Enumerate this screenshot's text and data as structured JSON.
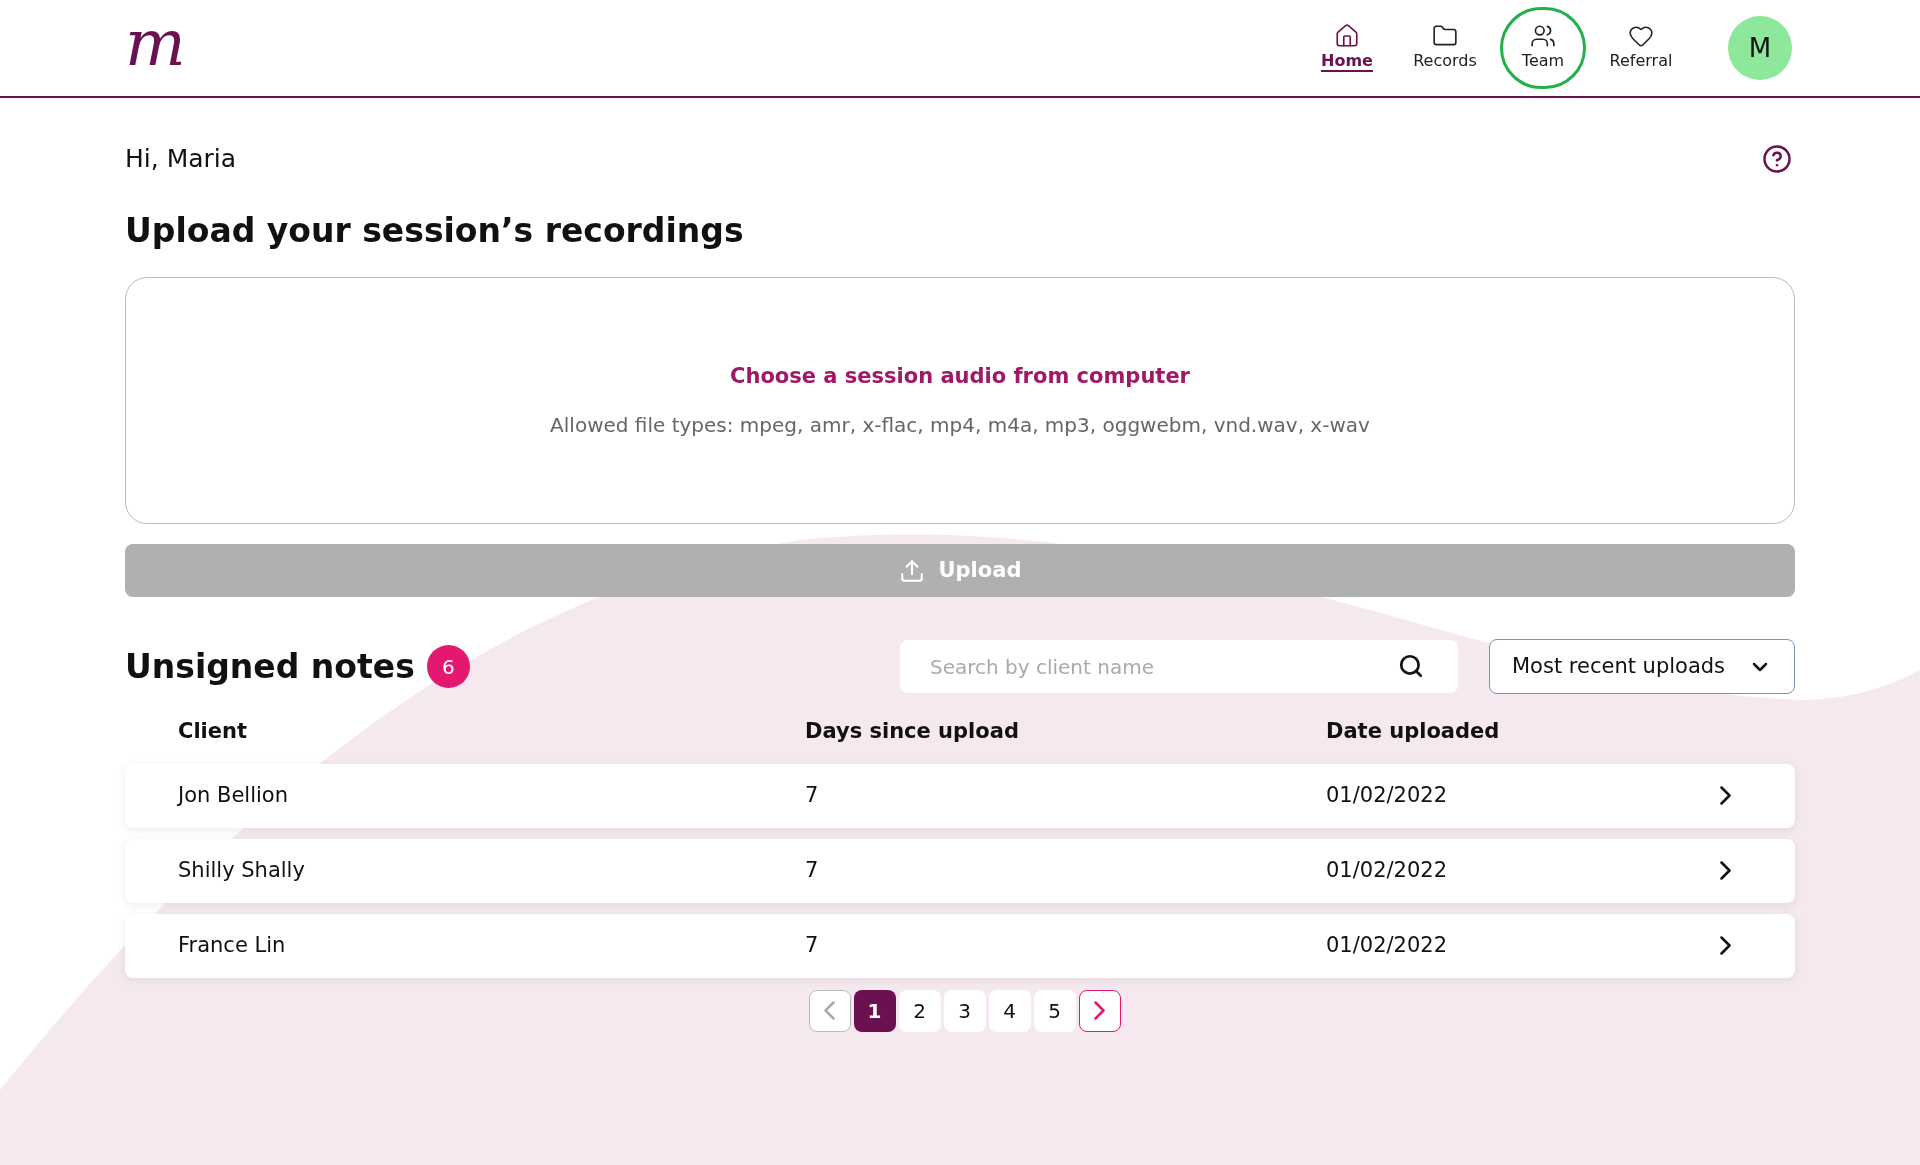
{
  "header": {
    "logo": "m",
    "nav": [
      {
        "label": "Home",
        "selected": true,
        "focused": false
      },
      {
        "label": "Records",
        "selected": false,
        "focused": false
      },
      {
        "label": "Team",
        "selected": false,
        "focused": true
      },
      {
        "label": "Referral",
        "selected": false,
        "focused": false
      }
    ],
    "avatar": "M"
  },
  "greeting": "Hi, Maria",
  "title": "Upload your session’s recordings",
  "dropzone": {
    "link": "Choose a session audio from computer",
    "hint": "Allowed file types: mpeg, amr, x-flac, mp4, m4a, mp3, oggwebm, vnd.wav, x-wav"
  },
  "upload_button": {
    "label": "Upload",
    "disabled": true
  },
  "notes": {
    "title": "Unsigned notes",
    "count": "6",
    "search": {
      "placeholder": "Search by client name"
    },
    "sort": {
      "value": "Most recent uploads"
    },
    "columns": [
      "Client",
      "Days since upload",
      "Date uploaded"
    ],
    "rows": [
      [
        "Jon Bellion",
        "7",
        "01/02/2022"
      ],
      [
        "Shilly Shally",
        "7",
        "01/02/2022"
      ],
      [
        "France Lin",
        "7",
        "01/02/2022"
      ]
    ]
  },
  "pagination": {
    "prev_disabled": true,
    "next_disabled": false,
    "pages": [
      {
        "label": "1",
        "selected": true
      },
      {
        "label": "2",
        "selected": false
      },
      {
        "label": "3",
        "selected": false
      },
      {
        "label": "4",
        "selected": false
      },
      {
        "label": "5",
        "selected": false
      }
    ]
  }
}
